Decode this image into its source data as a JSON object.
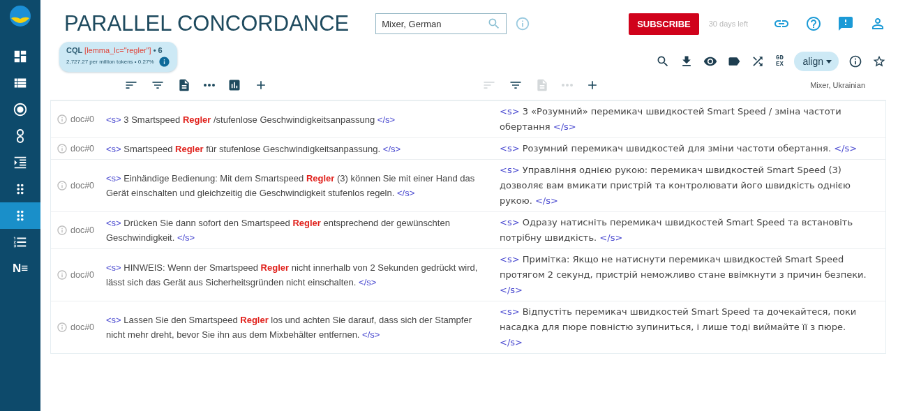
{
  "sidebar": {
    "items": [
      {
        "kind": "dashboard",
        "selected": false
      },
      {
        "kind": "list",
        "selected": false
      },
      {
        "kind": "target",
        "selected": false
      },
      {
        "kind": "chain",
        "selected": false
      },
      {
        "kind": "indent",
        "selected": false
      },
      {
        "kind": "dots",
        "selected": false
      },
      {
        "kind": "dots",
        "selected": true
      },
      {
        "kind": "sort",
        "selected": false
      },
      {
        "kind": "ngram",
        "label": "N≡",
        "selected": false
      }
    ]
  },
  "header": {
    "title": "PARALLEL CONCORDANCE",
    "search": {
      "value": "Mixer, German"
    },
    "subscribe": "SUBSCRIBE",
    "trial": "30 days left",
    "icons": [
      {
        "kind": "link"
      },
      {
        "kind": "help"
      },
      {
        "kind": "feedback"
      },
      {
        "kind": "user"
      }
    ]
  },
  "query": {
    "label": "CQL",
    "query": "[lemma_lc=\"regler\"]",
    "count": "• 6",
    "stats": "2,727.27 per million tokens • 0.27%"
  },
  "actions": [
    {
      "kind": "search"
    },
    {
      "kind": "download"
    },
    {
      "kind": "view"
    },
    {
      "kind": "tag"
    },
    {
      "kind": "shuffle"
    },
    {
      "kind": "gdex",
      "label": "GD EX"
    },
    {
      "kind": "menu",
      "label": "align"
    },
    {
      "kind": "info"
    },
    {
      "kind": "star"
    }
  ],
  "left_toolbar": [
    {
      "kind": "sort",
      "disabled": false
    },
    {
      "kind": "filter",
      "disabled": false
    },
    {
      "kind": "doc",
      "disabled": false
    },
    {
      "kind": "dots",
      "disabled": false
    },
    {
      "kind": "chart",
      "disabled": false
    },
    {
      "kind": "add",
      "disabled": false
    }
  ],
  "right_toolbar": [
    {
      "kind": "sort",
      "disabled": true
    },
    {
      "kind": "filter",
      "disabled": false
    },
    {
      "kind": "doc",
      "disabled": true
    },
    {
      "kind": "dots",
      "disabled": true
    },
    {
      "kind": "add",
      "disabled": false
    }
  ],
  "right_corpus": "Mixer, Ukrainian",
  "rows": [
    {
      "doc": "doc#0",
      "left": {
        "open": "<s>",
        "before": "3 Smartspeed",
        "hit": "Regler",
        "after": "/stufenlose Geschwindigkeitsanpassung",
        "close": "</s>"
      },
      "right": {
        "open": "<s>",
        "text": "3 «Розумний» перемикач швидкостей Smart Speed / зміна частоти обертання",
        "close": "</s>"
      }
    },
    {
      "doc": "doc#0",
      "left": {
        "open": "<s>",
        "before": "Smartspeed",
        "hit": "Regler",
        "after": "für stufenlose Geschwindigkeitsanpassung.",
        "close": "</s>"
      },
      "right": {
        "open": "<s>",
        "text": "Розумний перемикач швидкостей для зміни частоти обертання.",
        "close": "</s>"
      }
    },
    {
      "doc": "doc#0",
      "left": {
        "open": "<s>",
        "before": "Einhändige Bedienung: Mit dem Smartspeed",
        "hit": "Regler",
        "after": "(3) können Sie mit einer Hand das Gerät einschalten und gleichzeitig die Geschwindigkeit stufenlos regeln.",
        "close": "</s>"
      },
      "right": {
        "open": "<s>",
        "text": "Управління однією рукою: перемикач швидкостей Smart Speed (3) дозволяє вам вмикати пристрій та контролювати його швидкість однією рукою.",
        "close": "</s>"
      }
    },
    {
      "doc": "doc#0",
      "left": {
        "open": "<s>",
        "before": "Drücken Sie dann sofort den Smartspeed",
        "hit": "Regler",
        "after": "entsprechend der gewünschten Geschwindigkeit.",
        "close": "</s>"
      },
      "right": {
        "open": "<s>",
        "text": "Одразу натисніть перемикач швидкостей Smart Speed та встановіть потрібну швидкість.",
        "close": "</s>"
      }
    },
    {
      "doc": "doc#0",
      "left": {
        "open": "<s>",
        "before": "HINWEIS: Wenn der Smartspeed",
        "hit": "Regler",
        "after": "nicht innerhalb von 2 Sekunden gedrückt wird, lässt sich das Gerät aus Sicherheitsgründen nicht einschalten.",
        "close": "</s>"
      },
      "right": {
        "open": "<s>",
        "text": "Примітка: Якщо не натиснути перемикач швидкостей Smart Speed протягом 2 секунд, пристрій неможливо стане ввімкнути з причин безпеки.",
        "close": "</s>"
      }
    },
    {
      "doc": "doc#0",
      "left": {
        "open": "<s>",
        "before": "Lassen Sie den Smartspeed",
        "hit": "Regler",
        "after": "los und achten Sie darauf, dass sich der Stampfer nicht mehr dreht, bevor Sie ihn aus dem Mixbehälter entfernen.",
        "close": "</s>"
      },
      "right": {
        "open": "<s>",
        "text": "Відпустіть перемикач швидкостей Smart Speed та дочекайтеся, поки насадка для пюре повністю зупиниться, і лише тоді виймайте її з пюре.",
        "close": "</s>"
      }
    }
  ]
}
